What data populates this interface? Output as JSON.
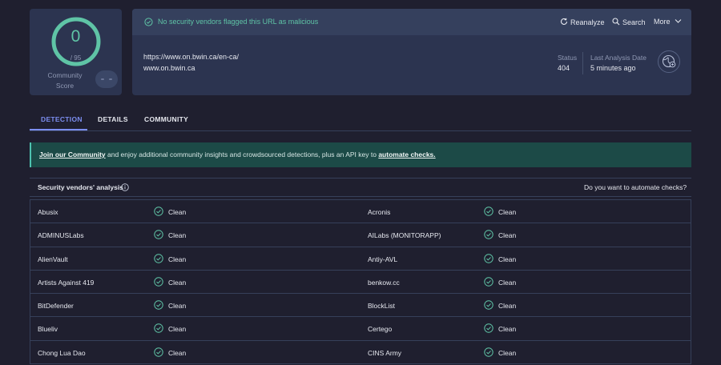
{
  "score": {
    "value": "0",
    "total": "/ 95",
    "label_line1": "Community",
    "label_line2": "Score"
  },
  "summary": {
    "message": "No security vendors flagged this URL as malicious",
    "actions": {
      "reanalyze": "Reanalyze",
      "search": "Search",
      "more": "More"
    },
    "url": "https://www.on.bwin.ca/en-ca/",
    "host": "www.on.bwin.ca",
    "status_label": "Status",
    "status_value": "404",
    "last_analysis_label": "Last Analysis Date",
    "last_analysis_value": "5 minutes ago"
  },
  "tabs": [
    {
      "label": "DETECTION"
    },
    {
      "label": "DETAILS"
    },
    {
      "label": "COMMUNITY"
    }
  ],
  "banner": {
    "link1": "Join our Community",
    "text": " and enjoy additional community insights and crowdsourced detections, plus an API key to ",
    "link2": "automate checks."
  },
  "analysis": {
    "title": "Security vendors' analysis",
    "automate_question": "Do you want to automate checks?"
  },
  "vendors": [
    {
      "left": "Abusix",
      "left_result": "Clean",
      "right": "Acronis",
      "right_result": "Clean"
    },
    {
      "left": "ADMINUSLabs",
      "left_result": "Clean",
      "right": "AILabs (MONITORAPP)",
      "right_result": "Clean"
    },
    {
      "left": "AlienVault",
      "left_result": "Clean",
      "right": "Antiy-AVL",
      "right_result": "Clean"
    },
    {
      "left": "Artists Against 419",
      "left_result": "Clean",
      "right": "benkow.cc",
      "right_result": "Clean"
    },
    {
      "left": "BitDefender",
      "left_result": "Clean",
      "right": "BlockList",
      "right_result": "Clean"
    },
    {
      "left": "Blueliv",
      "left_result": "Clean",
      "right": "Certego",
      "right_result": "Clean"
    },
    {
      "left": "Chong Lua Dao",
      "left_result": "Clean",
      "right": "CINS Army",
      "right_result": "Clean"
    }
  ],
  "colors": {
    "clean": "#5fc4a6",
    "accent": "#7c8ef0",
    "banner_bg": "#1c4a47"
  }
}
